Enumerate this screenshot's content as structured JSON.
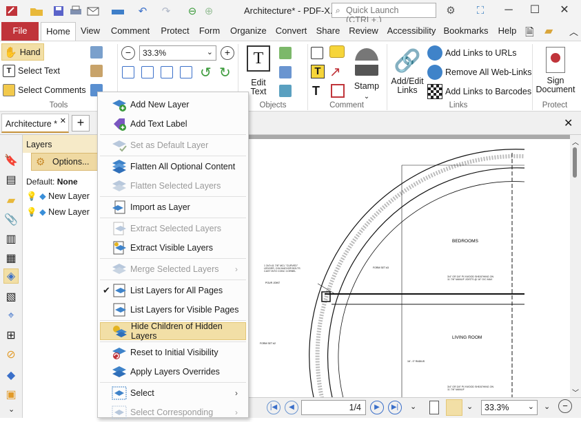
{
  "window": {
    "title": "Architecture* - PDF-X...",
    "quick_launch_placeholder": "Quick Launch (CTRL+.)"
  },
  "ribbon_tabs": [
    "File",
    "Home",
    "View",
    "Comment",
    "Protect",
    "Form",
    "Organize",
    "Convert",
    "Share",
    "Review",
    "Accessibility",
    "Bookmarks",
    "Help"
  ],
  "ribbon": {
    "tools": {
      "hand": "Hand",
      "select_text": "Select Text",
      "select_comments": "Select Comments",
      "label": "Tools"
    },
    "zoom_value": "33.3%",
    "objects": {
      "edit_text": "Edit\nText",
      "label": "Objects"
    },
    "comment": {
      "stamp": "Stamp",
      "label": "Comment"
    },
    "links": {
      "add_edit_links": "Add/Edit\nLinks",
      "add_links_urls": "Add Links to URLs",
      "remove_web_links": "Remove All Web-Links",
      "add_links_barcodes": "Add Links to Barcodes",
      "label": "Links"
    },
    "protect": {
      "sign_document": "Sign\nDocument",
      "label": "Protect"
    }
  },
  "doc_tab": {
    "name": "Architecture *"
  },
  "layers_panel": {
    "title": "Layers",
    "options_label": "Options...",
    "default_label": "Default:",
    "default_value": "None",
    "items": [
      "New Layer",
      "New Layer"
    ]
  },
  "context_menu": {
    "items": [
      {
        "label": "Add New Layer",
        "enabled": true
      },
      {
        "label": "Add Text Label",
        "enabled": true
      },
      {
        "label": "Set as Default Layer",
        "enabled": false
      },
      {
        "label": "Flatten All Optional Content",
        "enabled": true
      },
      {
        "label": "Flatten Selected Layers",
        "enabled": false
      },
      {
        "label": "Import as Layer",
        "enabled": true
      },
      {
        "label": "Extract Selected Layers",
        "enabled": false
      },
      {
        "label": "Extract Visible Layers",
        "enabled": true
      },
      {
        "label": "Merge Selected Layers",
        "enabled": false
      },
      {
        "label": "List Layers for All Pages",
        "enabled": true
      },
      {
        "label": "List Layers for Visible Pages",
        "enabled": true
      },
      {
        "label": "Hide Children of Hidden Layers",
        "enabled": true
      },
      {
        "label": "Reset to Initial Visibility",
        "enabled": true
      },
      {
        "label": "Apply Layers Overrides",
        "enabled": true
      },
      {
        "label": "Select",
        "enabled": true
      },
      {
        "label": "Select Corresponding",
        "enabled": false
      }
    ]
  },
  "drawing_labels": {
    "bedrooms": "BEDROOMS",
    "living_room": "LIVING ROOM",
    "form_set_3": "FORM SET #3",
    "form_set_2": "FORM SET #2",
    "pour_joint": "POUR JOINT",
    "ledger_note": "1 3/4\"x11 7/8\" MCL \"CURVED\" LEDGER, C/W ANCHOR BOLTS CAST INTO CONC CORBEL",
    "plywood_note_1": "3/4\" OR 3/4\" PLYWOOD SHEATHING ON 11 7/8\" MANUF JOISTS @ 16\" O/C MAX",
    "plywood_note_2": "3/4\" OR 3/4\" PLYWOOD SHEATHING ON 11 7/8\" MANUF",
    "radius_note": "16' - 0\" RADIUS"
  },
  "status": {
    "page_current": "1",
    "page_total": "/4",
    "zoom": "33.3%"
  },
  "colors": {
    "file_tab": "#c0343a",
    "highlight": "#f2dfa6",
    "accent": "#c6923a"
  }
}
